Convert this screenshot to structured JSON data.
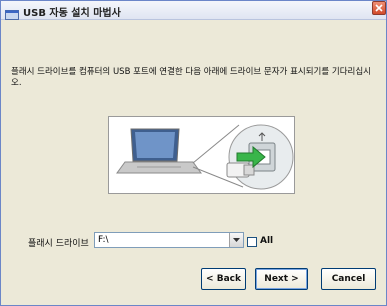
{
  "window": {
    "title": "USB 자동 설치 마법사"
  },
  "instruction": "플래시 드라이브를 컴퓨터의 USB 포트에 연결한 다음 아래에 드라이브 문자가 표시되기를 기다리십시오.",
  "drive": {
    "label": "플래시 드라이브",
    "value": "F:\\",
    "all_label": "All",
    "all_checked": false
  },
  "buttons": {
    "back": "< Back",
    "next": "Next >",
    "cancel": "Cancel"
  },
  "icons": {
    "app": "window-app-icon",
    "close": "close-icon",
    "dropdown": "chevron-down-icon"
  },
  "colors": {
    "title_bar": "#e6ebf6",
    "close": "#d24b2b",
    "dialog_bg": "#ece9d8",
    "usb_arrow": "#39b54a"
  }
}
